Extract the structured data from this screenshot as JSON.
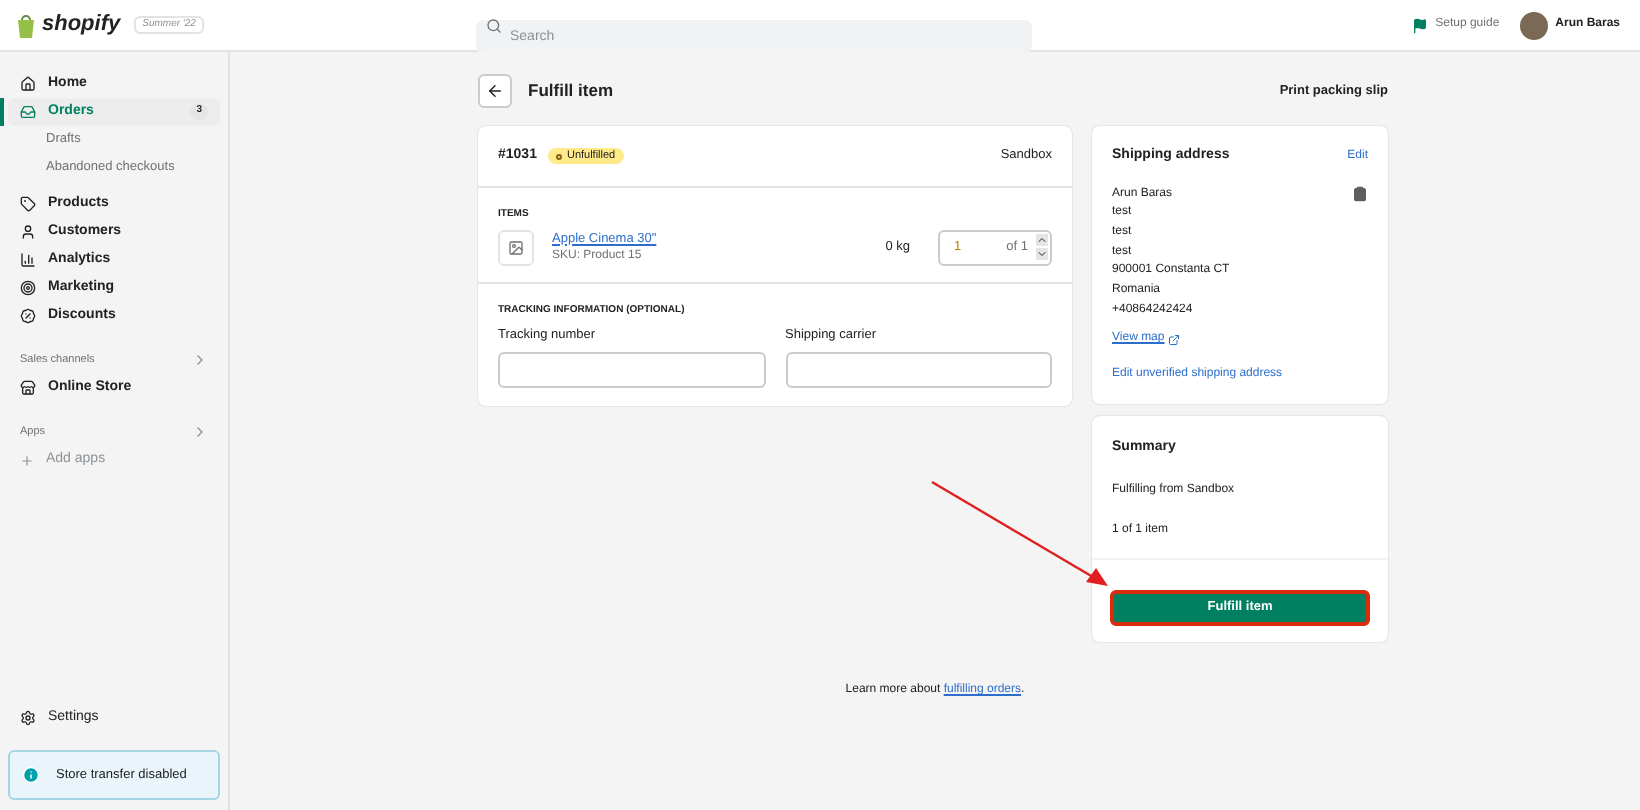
{
  "topbar": {
    "logo": "shopify",
    "edition": "Summer '22",
    "search": {
      "placeholder": "Search"
    },
    "setup_guide": "Setup guide",
    "user": "Arun Baras"
  },
  "sidebar": {
    "items": [
      {
        "kind": "main",
        "label": "Home",
        "selected": false
      },
      {
        "kind": "main",
        "label": "Orders",
        "selected": true,
        "badge": "3"
      },
      {
        "kind": "sub",
        "label": "Drafts",
        "selected": false
      },
      {
        "kind": "sub",
        "label": "Abandoned checkouts",
        "selected": false
      },
      {
        "kind": "main",
        "label": "Products",
        "selected": false
      },
      {
        "kind": "main",
        "label": "Customers",
        "selected": false
      },
      {
        "kind": "main",
        "label": "Analytics",
        "selected": false
      },
      {
        "kind": "main",
        "label": "Marketing",
        "selected": false
      },
      {
        "kind": "main",
        "label": "Discounts",
        "selected": false
      },
      {
        "kind": "section",
        "label": "Sales channels"
      },
      {
        "kind": "main",
        "label": "Online Store",
        "selected": false
      },
      {
        "kind": "section",
        "label": "Apps"
      },
      {
        "kind": "add",
        "label": "Add apps"
      }
    ],
    "settings": "Settings",
    "notice": "Store transfer disabled"
  },
  "page": {
    "title": "Fulfill item",
    "print": "Print packing slip",
    "order": {
      "number": "#1031",
      "status": "Unfulfilled",
      "location": "Sandbox",
      "items_heading": "ITEMS",
      "item": {
        "name": "Apple Cinema 30\"",
        "sku": "SKU: Product 15",
        "weight": "0 kg",
        "quantity": "1",
        "of": "of 1"
      },
      "tracking_heading": "TRACKING INFORMATION (OPTIONAL)",
      "tracking_label": "Tracking number",
      "carrier_label": "Shipping carrier"
    },
    "shipping": {
      "title": "Shipping address",
      "edit": "Edit",
      "lines": [
        "Arun Baras",
        "test",
        "test",
        "test",
        "900001 Constanta CT",
        "Romania",
        "+40864242424"
      ],
      "view_map": "View map",
      "edit_unverified": "Edit unverified shipping address"
    },
    "summary": {
      "title": "Summary",
      "from": "Fulfilling from Sandbox",
      "count": "1 of 1 item",
      "button": "Fulfill item"
    },
    "footer": {
      "text": "Learn more about ",
      "link": "fulfilling orders",
      "end": "."
    }
  }
}
